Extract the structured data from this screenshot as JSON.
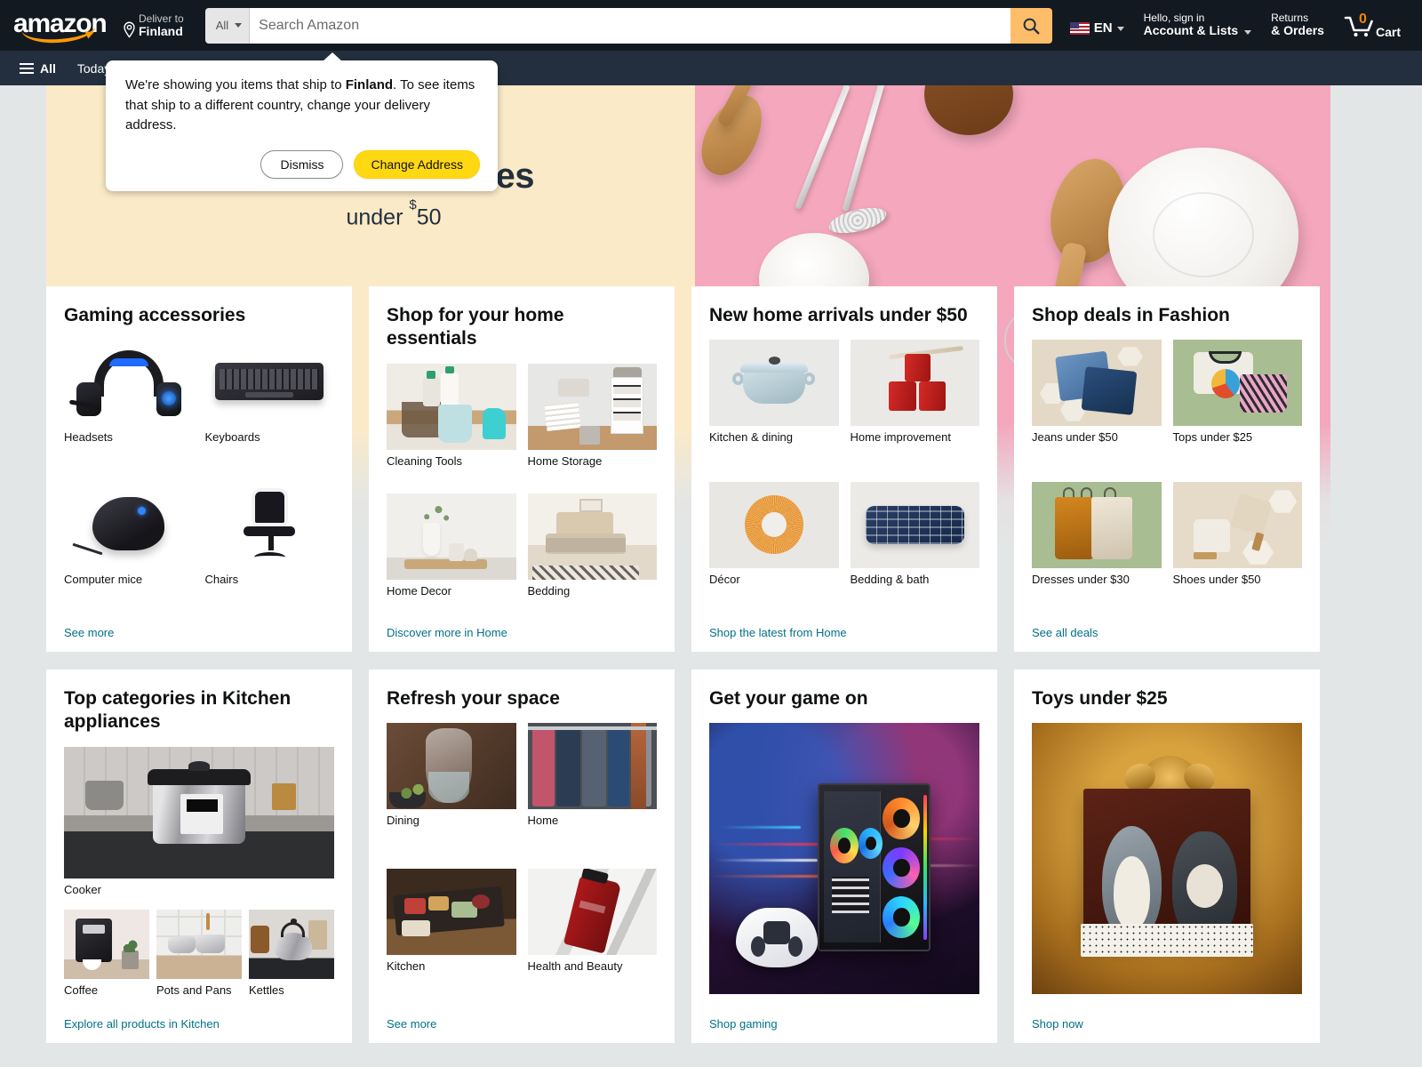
{
  "header": {
    "logo_alt": "amazon",
    "deliver_label": "Deliver to",
    "deliver_country": "Finland",
    "search": {
      "category": "All",
      "placeholder": "Search Amazon",
      "value": ""
    },
    "language": "EN",
    "account_line1": "Hello, sign in",
    "account_line2": "Account & Lists",
    "orders_line1": "Returns",
    "orders_line2": "& Orders",
    "cart_count": "0",
    "cart_label": "Cart"
  },
  "subnav": {
    "all": "All",
    "items": [
      "Today's"
    ]
  },
  "tooltip": {
    "text_before": "We're showing you items that ship to ",
    "country": "Finland",
    "text_after": ". To see items that ship to a different country, change your delivery address.",
    "dismiss": "Dismiss",
    "change": "Change Address"
  },
  "hero": {
    "title": "Kitchen favorites",
    "subtitle_prefix": "under ",
    "subtitle_currency": "$",
    "subtitle_amount": "50",
    "prev_label": "Previous slide",
    "next_label": "Next slide"
  },
  "cards": [
    {
      "title": "Gaming accessories",
      "link": "See more",
      "items": [
        {
          "label": "Headsets"
        },
        {
          "label": "Keyboards"
        },
        {
          "label": "Computer mice"
        },
        {
          "label": "Chairs"
        }
      ]
    },
    {
      "title": "Shop for your home essentials",
      "link": "Discover more in Home",
      "items": [
        {
          "label": "Cleaning Tools"
        },
        {
          "label": "Home Storage"
        },
        {
          "label": "Home Decor"
        },
        {
          "label": "Bedding"
        }
      ]
    },
    {
      "title": "New home arrivals under $50",
      "link": "Shop the latest from Home",
      "items": [
        {
          "label": "Kitchen & dining"
        },
        {
          "label": "Home improvement"
        },
        {
          "label": "Décor"
        },
        {
          "label": "Bedding & bath"
        }
      ]
    },
    {
      "title": "Shop deals in Fashion",
      "link": "See all deals",
      "items": [
        {
          "label": "Jeans under $50"
        },
        {
          "label": "Tops under $25"
        },
        {
          "label": "Dresses under $30"
        },
        {
          "label": "Shoes under $50"
        }
      ]
    },
    {
      "title": "Top categories in Kitchen appliances",
      "link": "Explore all products in Kitchen",
      "hero_item": {
        "label": "Cooker"
      },
      "items": [
        {
          "label": "Coffee"
        },
        {
          "label": "Pots and Pans"
        },
        {
          "label": "Kettles"
        }
      ]
    },
    {
      "title": "Refresh your space",
      "link": "See more",
      "items": [
        {
          "label": "Dining"
        },
        {
          "label": "Home"
        },
        {
          "label": "Kitchen"
        },
        {
          "label": "Health and Beauty"
        }
      ]
    },
    {
      "title": "Get your game on",
      "link": "Shop gaming",
      "items": []
    },
    {
      "title": "Toys under $25",
      "link": "Shop now",
      "items": []
    }
  ],
  "colors": {
    "nav_bg": "#131921",
    "subnav_bg": "#232f3e",
    "page_bg": "#e3e6e6",
    "accent_orange": "#febd69",
    "link_teal": "#007185",
    "hero_cream": "#fbeac7",
    "cta_yellow": "#ffd814"
  }
}
